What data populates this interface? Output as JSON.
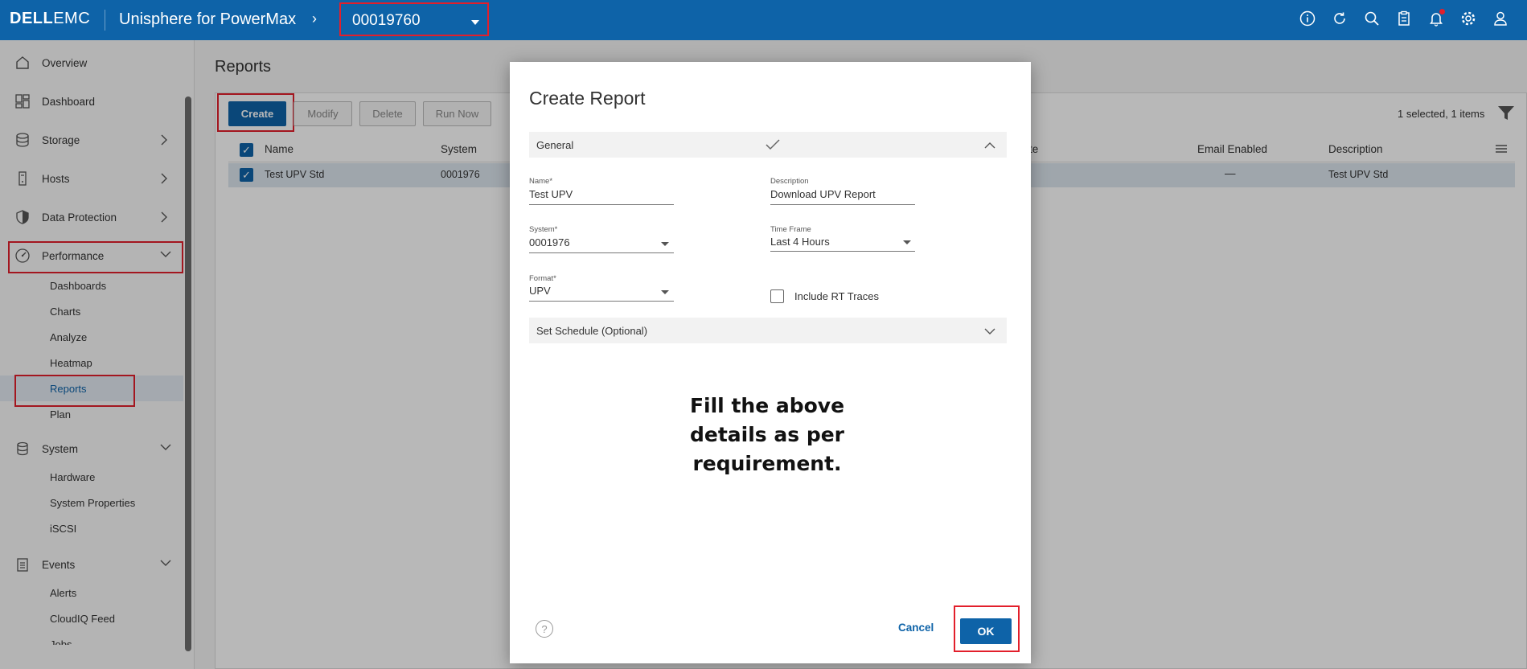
{
  "header": {
    "logo_bold": "D&#x0190;LL",
    "logo_brand": "DELL",
    "logo_rest": "EMC",
    "app_title": "Unisphere for PowerMax",
    "system_id": "00019760"
  },
  "sidebar": {
    "items": [
      {
        "label": "Overview"
      },
      {
        "label": "Dashboard"
      },
      {
        "label": "Storage"
      },
      {
        "label": "Hosts"
      },
      {
        "label": "Data Protection"
      },
      {
        "label": "Performance"
      },
      {
        "label": "System"
      },
      {
        "label": "Events"
      }
    ],
    "performance_sub": [
      "Dashboards",
      "Charts",
      "Analyze",
      "Heatmap",
      "Reports",
      "Plan"
    ],
    "system_sub": [
      "Hardware",
      "System Properties",
      "iSCSI"
    ],
    "events_sub": [
      "Alerts",
      "CloudIQ Feed",
      "Jobs"
    ]
  },
  "main": {
    "title": "Reports",
    "toolbar": {
      "create": "Create",
      "modify": "Modify",
      "delete": "Delete",
      "run_now": "Run Now"
    },
    "selection_info": "1 selected, 1 items",
    "columns": {
      "name": "Name",
      "system": "System",
      "date": "te",
      "email": "Email Enabled",
      "description": "Description"
    },
    "row": {
      "name": "Test UPV Std",
      "system": "0001976",
      "email": "—",
      "description": "Test UPV Std"
    }
  },
  "dialog": {
    "title": "Create Report",
    "general_label": "General",
    "name_label": "Name*",
    "name_value": "Test UPV",
    "description_label": "Description",
    "description_value": "Download UPV Report",
    "system_label": "System*",
    "system_value": "0001976",
    "timeframe_label": "Time Frame",
    "timeframe_value": "Last 4 Hours",
    "format_label": "Format*",
    "format_value": "UPV",
    "include_rt_label": "Include RT Traces",
    "schedule_label": "Set Schedule (Optional)",
    "note_lines": [
      "Fill the above",
      "details as per",
      "requirement."
    ],
    "cancel_label": "Cancel",
    "ok_label": "OK",
    "help_symbol": "?"
  },
  "colors": {
    "brand_blue": "#0e63a8",
    "annotation_red": "#e21f2b"
  }
}
